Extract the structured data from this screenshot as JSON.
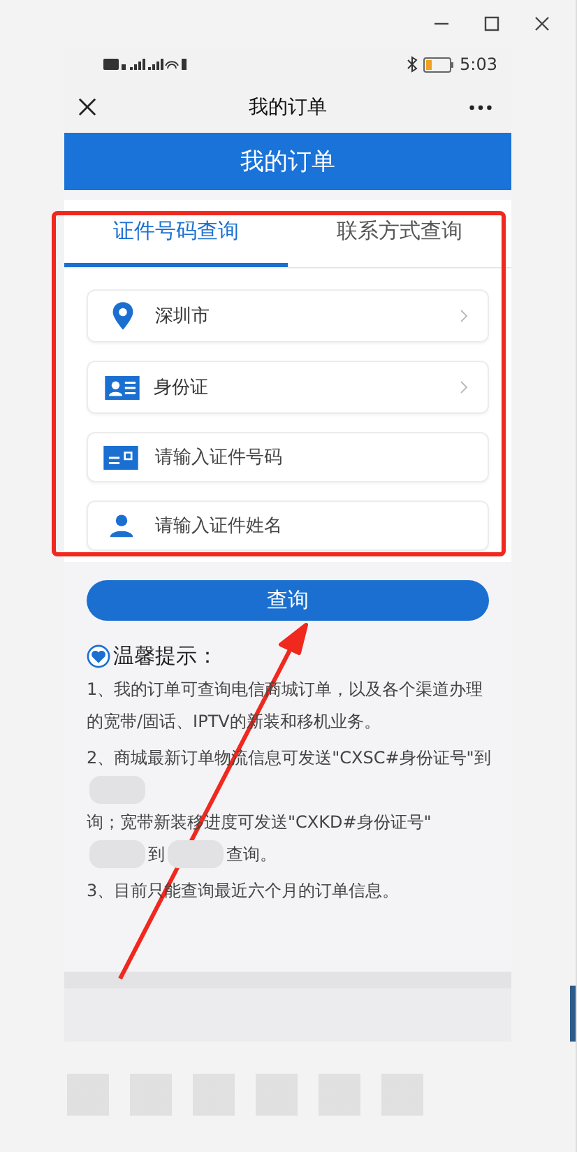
{
  "status_bar": {
    "time": "5:03"
  },
  "nav_bar": {
    "title": "我的订单"
  },
  "header": {
    "title": "我的订单"
  },
  "tabs": [
    {
      "label": "证件号码查询",
      "selected": true
    },
    {
      "label": "联系方式查询",
      "selected": false
    }
  ],
  "form_rows": [
    {
      "kind": "select",
      "value": "深圳市"
    },
    {
      "kind": "select",
      "value": "身份证"
    },
    {
      "kind": "input",
      "placeholder": "请输入证件号码"
    },
    {
      "kind": "input",
      "placeholder": "请输入证件姓名"
    }
  ],
  "query_button": "查询",
  "tips": {
    "title": "温馨提示：",
    "items": [
      {
        "kind": "text",
        "text": "1、我的订单可查询电信商城订单，以及各个渠道办理的宽带/固话、IPTV的新装和移机业务。"
      },
      {
        "kind": "redacted",
        "segments": [
          "2、商城最新订单物流信息可发送\"CXSC#身份证号\"到",
          "询；宽带新装移进度可发送\"CXKD#身份证号\"",
          "到",
          "查询。"
        ]
      },
      {
        "kind": "text",
        "text": "3、目前只能查询最近六个月的订单信息。"
      }
    ]
  }
}
